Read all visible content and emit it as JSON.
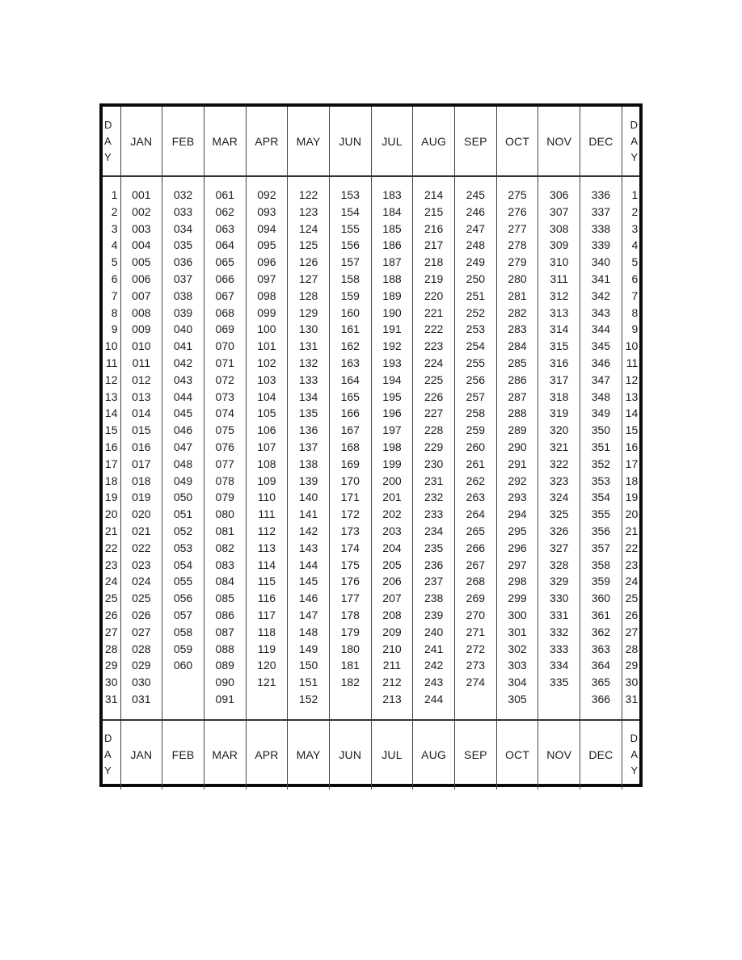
{
  "table": {
    "day_label": [
      "D",
      "A",
      "Y"
    ],
    "months": [
      "JAN",
      "FEB",
      "MAR",
      "APR",
      "MAY",
      "JUN",
      "JUL",
      "AUG",
      "SEP",
      "OCT",
      "NOV",
      "DEC"
    ],
    "days": [
      "1",
      "2",
      "3",
      "4",
      "5",
      "6",
      "7",
      "8",
      "9",
      "10",
      "11",
      "12",
      "13",
      "14",
      "15",
      "16",
      "17",
      "18",
      "19",
      "20",
      "21",
      "22",
      "23",
      "24",
      "25",
      "26",
      "27",
      "28",
      "29",
      "30",
      "31"
    ],
    "rows": [
      [
        "001",
        "032",
        "061",
        "092",
        "122",
        "153",
        "183",
        "214",
        "245",
        "275",
        "306",
        "336"
      ],
      [
        "002",
        "033",
        "062",
        "093",
        "123",
        "154",
        "184",
        "215",
        "246",
        "276",
        "307",
        "337"
      ],
      [
        "003",
        "034",
        "063",
        "094",
        "124",
        "155",
        "185",
        "216",
        "247",
        "277",
        "308",
        "338"
      ],
      [
        "004",
        "035",
        "064",
        "095",
        "125",
        "156",
        "186",
        "217",
        "248",
        "278",
        "309",
        "339"
      ],
      [
        "005",
        "036",
        "065",
        "096",
        "126",
        "157",
        "187",
        "218",
        "249",
        "279",
        "310",
        "340"
      ],
      [
        "006",
        "037",
        "066",
        "097",
        "127",
        "158",
        "188",
        "219",
        "250",
        "280",
        "311",
        "341"
      ],
      [
        "007",
        "038",
        "067",
        "098",
        "128",
        "159",
        "189",
        "220",
        "251",
        "281",
        "312",
        "342"
      ],
      [
        "008",
        "039",
        "068",
        "099",
        "129",
        "160",
        "190",
        "221",
        "252",
        "282",
        "313",
        "343"
      ],
      [
        "009",
        "040",
        "069",
        "100",
        "130",
        "161",
        "191",
        "222",
        "253",
        "283",
        "314",
        "344"
      ],
      [
        "010",
        "041",
        "070",
        "101",
        "131",
        "162",
        "192",
        "223",
        "254",
        "284",
        "315",
        "345"
      ],
      [
        "011",
        "042",
        "071",
        "102",
        "132",
        "163",
        "193",
        "224",
        "255",
        "285",
        "316",
        "346"
      ],
      [
        "012",
        "043",
        "072",
        "103",
        "133",
        "164",
        "194",
        "225",
        "256",
        "286",
        "317",
        "347"
      ],
      [
        "013",
        "044",
        "073",
        "104",
        "134",
        "165",
        "195",
        "226",
        "257",
        "287",
        "318",
        "348"
      ],
      [
        "014",
        "045",
        "074",
        "105",
        "135",
        "166",
        "196",
        "227",
        "258",
        "288",
        "319",
        "349"
      ],
      [
        "015",
        "046",
        "075",
        "106",
        "136",
        "167",
        "197",
        "228",
        "259",
        "289",
        "320",
        "350"
      ],
      [
        "016",
        "047",
        "076",
        "107",
        "137",
        "168",
        "198",
        "229",
        "260",
        "290",
        "321",
        "351"
      ],
      [
        "017",
        "048",
        "077",
        "108",
        "138",
        "169",
        "199",
        "230",
        "261",
        "291",
        "322",
        "352"
      ],
      [
        "018",
        "049",
        "078",
        "109",
        "139",
        "170",
        "200",
        "231",
        "262",
        "292",
        "323",
        "353"
      ],
      [
        "019",
        "050",
        "079",
        "110",
        "140",
        "171",
        "201",
        "232",
        "263",
        "293",
        "324",
        "354"
      ],
      [
        "020",
        "051",
        "080",
        "111",
        "141",
        "172",
        "202",
        "233",
        "264",
        "294",
        "325",
        "355"
      ],
      [
        "021",
        "052",
        "081",
        "112",
        "142",
        "173",
        "203",
        "234",
        "265",
        "295",
        "326",
        "356"
      ],
      [
        "022",
        "053",
        "082",
        "113",
        "143",
        "174",
        "204",
        "235",
        "266",
        "296",
        "327",
        "357"
      ],
      [
        "023",
        "054",
        "083",
        "114",
        "144",
        "175",
        "205",
        "236",
        "267",
        "297",
        "328",
        "358"
      ],
      [
        "024",
        "055",
        "084",
        "115",
        "145",
        "176",
        "206",
        "237",
        "268",
        "298",
        "329",
        "359"
      ],
      [
        "025",
        "056",
        "085",
        "116",
        "146",
        "177",
        "207",
        "238",
        "269",
        "299",
        "330",
        "360"
      ],
      [
        "026",
        "057",
        "086",
        "117",
        "147",
        "178",
        "208",
        "239",
        "270",
        "300",
        "331",
        "361"
      ],
      [
        "027",
        "058",
        "087",
        "118",
        "148",
        "179",
        "209",
        "240",
        "271",
        "301",
        "332",
        "362"
      ],
      [
        "028",
        "059",
        "088",
        "119",
        "149",
        "180",
        "210",
        "241",
        "272",
        "302",
        "333",
        "363"
      ],
      [
        "029",
        "060",
        "089",
        "120",
        "150",
        "181",
        "211",
        "242",
        "273",
        "303",
        "334",
        "364"
      ],
      [
        "030",
        "",
        "090",
        "121",
        "151",
        "182",
        "212",
        "243",
        "274",
        "304",
        "335",
        "365"
      ],
      [
        "031",
        "",
        "091",
        "",
        "152",
        "",
        "213",
        "244",
        "",
        "305",
        "",
        "366"
      ]
    ]
  }
}
